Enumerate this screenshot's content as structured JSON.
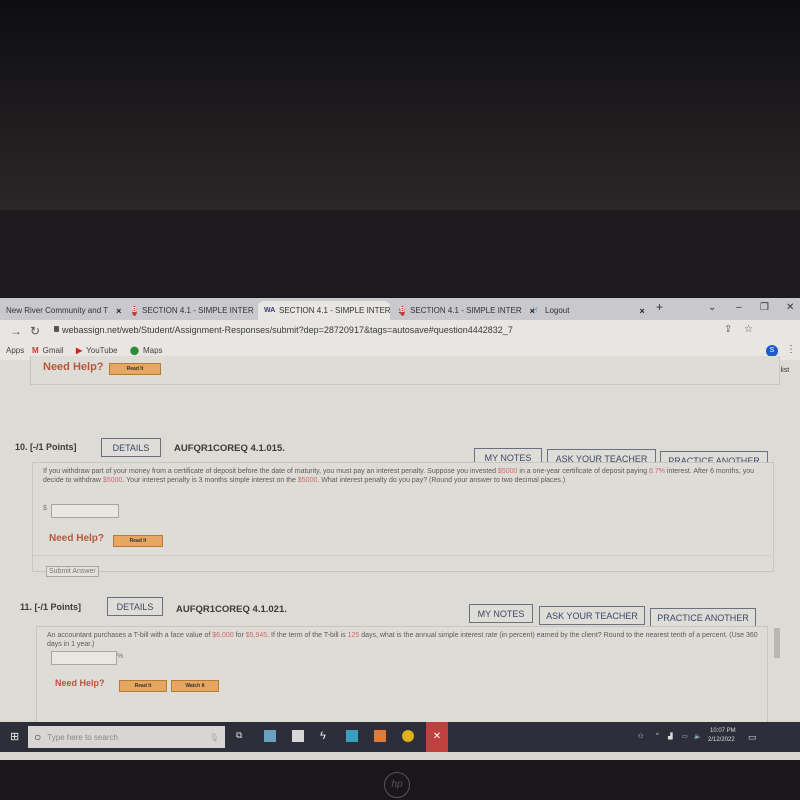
{
  "browser": {
    "tabs": [
      {
        "label": "New River Community and T",
        "icon": "college-icon",
        "active": false
      },
      {
        "label": "SECTION 4.1 - SIMPLE INTER",
        "icon": "b-logo-icon",
        "active": false
      },
      {
        "label": "SECTION 4.1 - SIMPLE INTER",
        "icon": "webassign-icon",
        "active": true
      },
      {
        "label": "SECTION 4.1 - SIMPLE INTER",
        "icon": "b-logo-icon",
        "active": false
      },
      {
        "label": "Logout",
        "icon": "loading-icon",
        "active": false
      }
    ],
    "new_tab": "+",
    "url": "webassign.net/web/Student/Assignment-Responses/submit?dep=28720917&tags=autosave#question4442832_7",
    "bookmarks": [
      {
        "label": "Apps",
        "icon": "apps-icon"
      },
      {
        "label": "Gmail",
        "icon": "gmail-icon"
      },
      {
        "label": "YouTube",
        "icon": "youtube-icon"
      },
      {
        "label": "Maps",
        "icon": "maps-icon"
      }
    ],
    "profile_initial": "S",
    "reading_list": "Reading list"
  },
  "page": {
    "prev_question": {
      "need_help": "Need Help?",
      "read_it": "Read It"
    },
    "questions": [
      {
        "number": "10.",
        "points": "[-/1 Points]",
        "details": "DETAILS",
        "code": "AUFQR1COREQ 4.1.015.",
        "my_notes": "MY NOTES",
        "ask_teacher": "ASK YOUR TEACHER",
        "practice": "PRACTICE ANOTHER",
        "text_parts": [
          "If you withdraw part of your money from a certificate of deposit before the date of maturity, you must pay an interest penalty. Suppose you invested ",
          "$5000",
          " in a one-year certificate of deposit paying ",
          "8.7%",
          " interest. After 6 months, you decide to withdraw ",
          "$5000",
          ". Your interest penalty is 3 months simple interest on the ",
          "$5000",
          ". What interest penalty do you pay? (Round your answer to two decimal places.)"
        ],
        "answer_prefix": "$",
        "answer_value": "",
        "need_help": "Need Help?",
        "read_it": "Read It",
        "submit": "Submit Answer"
      },
      {
        "number": "11.",
        "points": "[-/1 Points]",
        "details": "DETAILS",
        "code": "AUFQR1COREQ 4.1.021.",
        "my_notes": "MY NOTES",
        "ask_teacher": "ASK YOUR TEACHER",
        "practice": "PRACTICE ANOTHER",
        "text_parts": [
          "An accountant purchases a T-bill with a face value of ",
          "$6,000",
          " for ",
          "$5,945",
          ". If the term of the T-bill is ",
          "125",
          " days, what is the annual simple interest rate (in percent) earned by the client? Round to the nearest tenth of a percent. (Use 360 days in 1 year.)"
        ],
        "answer_suffix": "%",
        "answer_value": "",
        "need_help": "Need Help?",
        "read_it": "Read It",
        "watch_it": "Watch It"
      }
    ]
  },
  "taskbar": {
    "search_placeholder": "Type here to search",
    "time": "10:07 PM",
    "date": "2/12/2022"
  },
  "colors": {
    "need_help": "#b8563a",
    "read_it": "#e6a760",
    "highlight_red": "#d06a6a",
    "button_text": "#3c4766"
  }
}
